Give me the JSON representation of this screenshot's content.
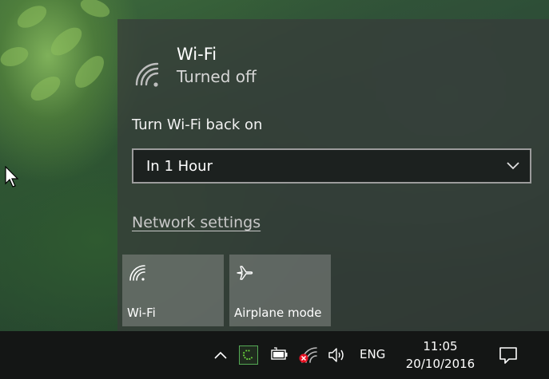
{
  "wifi_panel": {
    "title": "Wi-Fi",
    "status": "Turned off",
    "turn_on_label": "Turn Wi-Fi back on",
    "turn_on_selected": "In 1 Hour",
    "network_settings_link": "Network settings"
  },
  "quick_actions": [
    {
      "label": "Wi-Fi",
      "icon": "wifi-icon"
    },
    {
      "label": "Airplane mode",
      "icon": "airplane-icon"
    }
  ],
  "taskbar": {
    "language": "ENG",
    "time": "11:05",
    "date": "20/10/2016"
  },
  "colors": {
    "flyout_bg": "#3a3f3c",
    "taskbar_bg": "#141615",
    "tile_bg": "#8f948f",
    "error_red": "#e81123"
  }
}
